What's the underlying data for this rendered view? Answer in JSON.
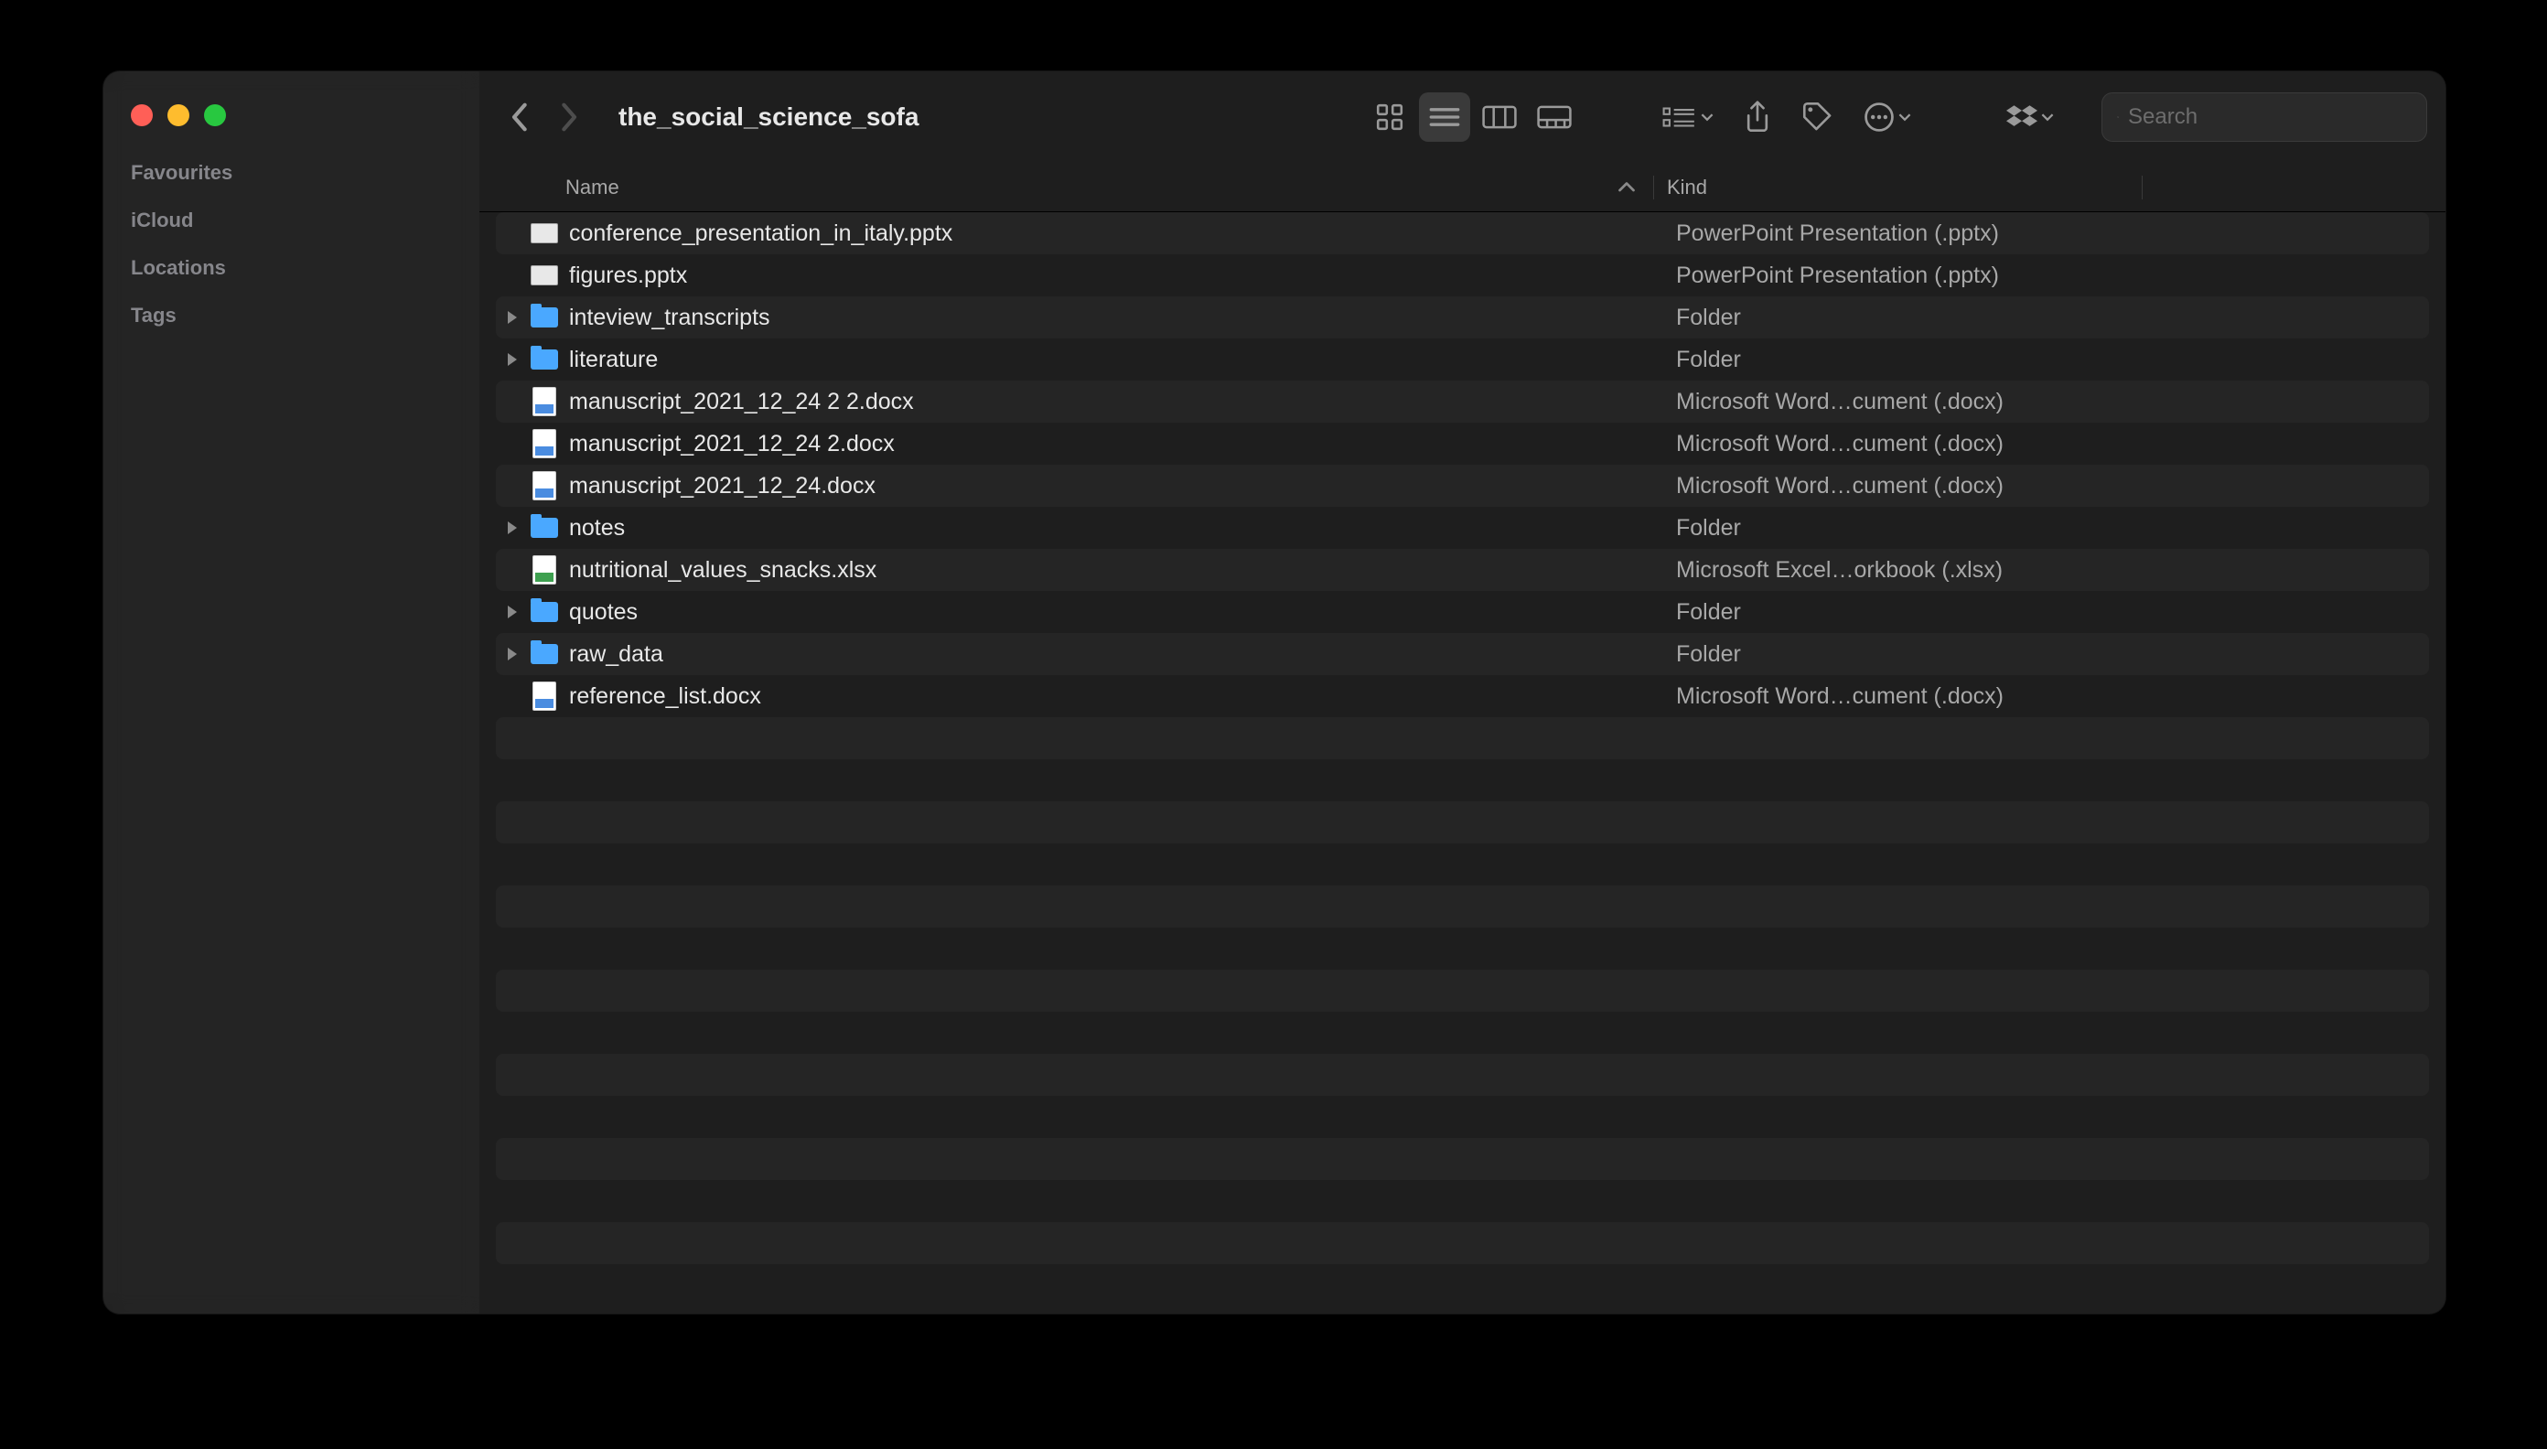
{
  "window": {
    "title": "the_social_science_sofa"
  },
  "sidebar": {
    "sections": [
      "Favourites",
      "iCloud",
      "Locations",
      "Tags"
    ]
  },
  "search": {
    "placeholder": "Search"
  },
  "columns": {
    "name": "Name",
    "kind": "Kind"
  },
  "files": [
    {
      "name": "conference_presentation_in_italy.pptx",
      "kind": "PowerPoint Presentation (.pptx)",
      "type": "pptx",
      "expandable": false
    },
    {
      "name": "figures.pptx",
      "kind": "PowerPoint Presentation (.pptx)",
      "type": "pptx",
      "expandable": false
    },
    {
      "name": "inteview_transcripts",
      "kind": "Folder",
      "type": "folder",
      "expandable": true
    },
    {
      "name": "literature",
      "kind": "Folder",
      "type": "folder",
      "expandable": true
    },
    {
      "name": "manuscript_2021_12_24 2 2.docx",
      "kind": "Microsoft Word…cument (.docx)",
      "type": "docx",
      "expandable": false
    },
    {
      "name": "manuscript_2021_12_24 2.docx",
      "kind": "Microsoft Word…cument (.docx)",
      "type": "docx",
      "expandable": false
    },
    {
      "name": "manuscript_2021_12_24.docx",
      "kind": "Microsoft Word…cument (.docx)",
      "type": "docx",
      "expandable": false
    },
    {
      "name": "notes",
      "kind": "Folder",
      "type": "folder",
      "expandable": true
    },
    {
      "name": "nutritional_values_snacks.xlsx",
      "kind": "Microsoft Excel…orkbook (.xlsx)",
      "type": "xlsx",
      "expandable": false
    },
    {
      "name": "quotes",
      "kind": "Folder",
      "type": "folder",
      "expandable": true
    },
    {
      "name": "raw_data",
      "kind": "Folder",
      "type": "folder",
      "expandable": true
    },
    {
      "name": "reference_list.docx",
      "kind": "Microsoft Word…cument (.docx)",
      "type": "docx",
      "expandable": false
    }
  ],
  "empty_rows": 14
}
